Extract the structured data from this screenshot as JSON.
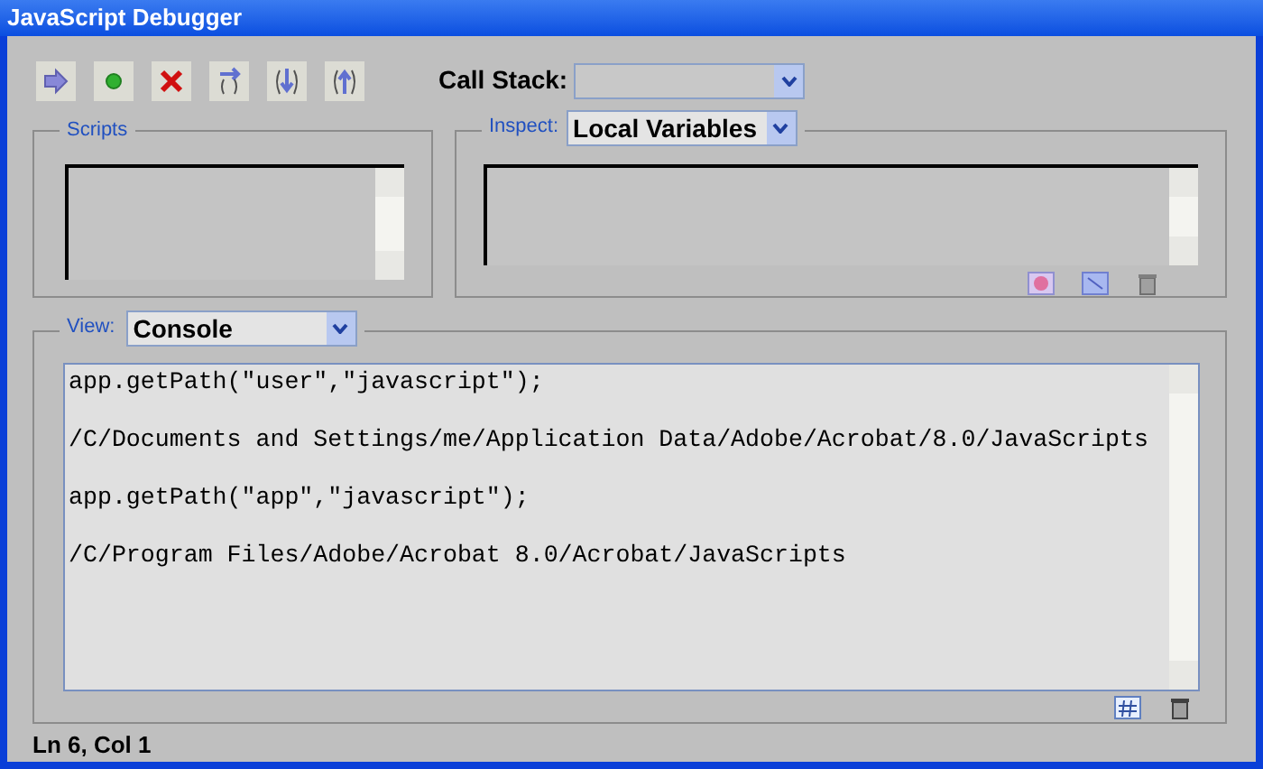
{
  "window": {
    "title": "JavaScript Debugger"
  },
  "call_stack": {
    "label": "Call Stack:"
  },
  "scripts": {
    "label": "Scripts"
  },
  "inspect": {
    "label": "Inspect:",
    "value": "Local Variables"
  },
  "view": {
    "label": "View:",
    "value": "Console"
  },
  "console": {
    "lines": [
      "app.getPath(\"user\",\"javascript\");",
      "/C/Documents and Settings/me/Application Data/Adobe/Acrobat/8.0/JavaScripts",
      "app.getPath(\"app\",\"javascript\");",
      "/C/Program Files/Adobe/Acrobat 8.0/Acrobat/JavaScripts"
    ]
  },
  "status_bar": "Ln 6, Col 1"
}
